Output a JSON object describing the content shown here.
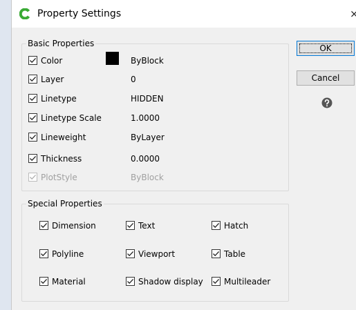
{
  "window": {
    "title": "Property Settings",
    "close_glyph": "×"
  },
  "basic_group": {
    "label": "Basic Properties",
    "items": [
      {
        "label": "Color",
        "checked": true,
        "enabled": true,
        "value": "ByBlock",
        "swatch_color": "#000000"
      },
      {
        "label": "Layer",
        "checked": true,
        "enabled": true,
        "value": "0"
      },
      {
        "label": "Linetype",
        "checked": true,
        "enabled": true,
        "value": "HIDDEN"
      },
      {
        "label": "Linetype Scale",
        "checked": true,
        "enabled": true,
        "value": "1.0000"
      },
      {
        "label": "Lineweight",
        "checked": true,
        "enabled": true,
        "value": "ByLayer"
      },
      {
        "label": "Thickness",
        "checked": true,
        "enabled": true,
        "value": "0.0000"
      },
      {
        "label": "PlotStyle",
        "checked": true,
        "enabled": false,
        "value": "ByBlock"
      }
    ]
  },
  "special_group": {
    "label": "Special Properties",
    "items": [
      {
        "label": "Dimension",
        "checked": true
      },
      {
        "label": "Text",
        "checked": true
      },
      {
        "label": "Hatch",
        "checked": true
      },
      {
        "label": "Polyline",
        "checked": true
      },
      {
        "label": "Viewport",
        "checked": true
      },
      {
        "label": "Table",
        "checked": true
      },
      {
        "label": "Material",
        "checked": true
      },
      {
        "label": "Shadow display",
        "checked": true
      },
      {
        "label": "Multileader",
        "checked": true
      }
    ]
  },
  "buttons": {
    "ok_label": "OK",
    "cancel_label": "Cancel",
    "help_icon": "question-circle-icon"
  },
  "colors": {
    "app_icon": "#3aaa35",
    "default_button_border": "#0078d7",
    "disabled_text": "#a0a0a0"
  }
}
